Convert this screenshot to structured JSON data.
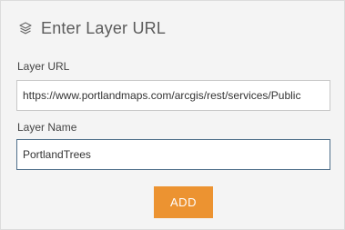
{
  "header": {
    "icon": "layers-icon",
    "title": "Enter Layer URL"
  },
  "form": {
    "layer_url": {
      "label": "Layer URL",
      "value": "https://www.portlandmaps.com/arcgis/rest/services/Public"
    },
    "layer_name": {
      "label": "Layer Name",
      "value": "PortlandTrees"
    },
    "add_label": "ADD"
  },
  "colors": {
    "accent": "#ec9331",
    "active_border": "#4f6f8a",
    "panel_bg": "#f4f4f4"
  }
}
